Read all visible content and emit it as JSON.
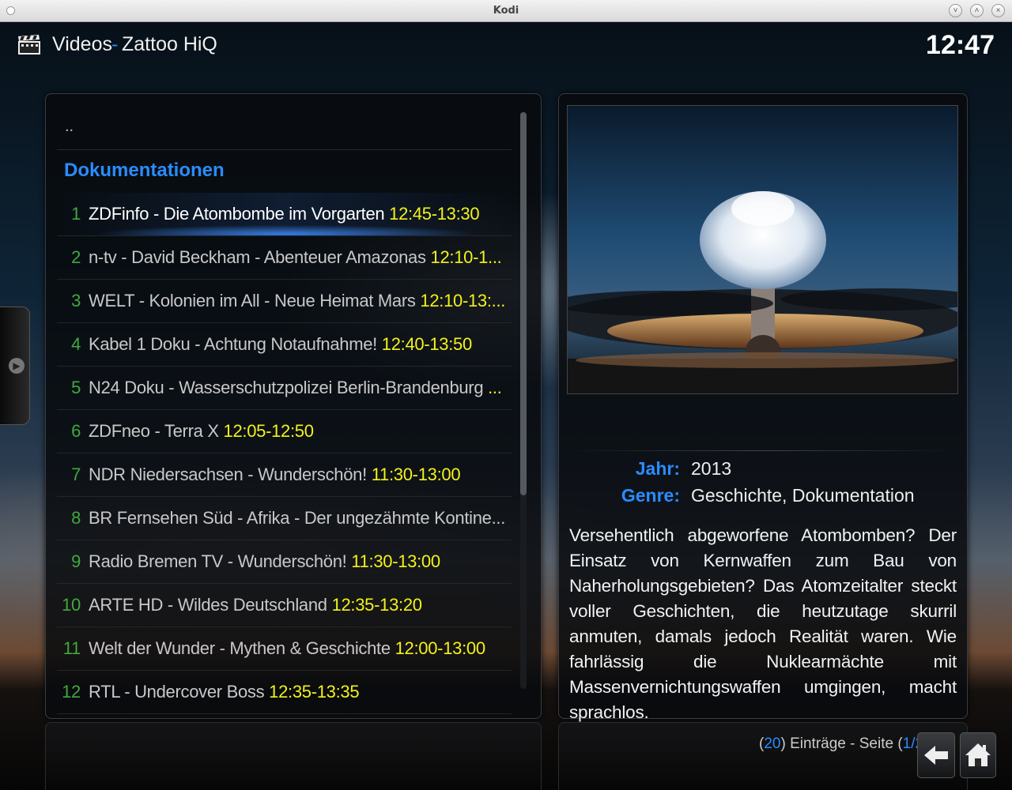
{
  "window": {
    "title": "Kodi"
  },
  "header": {
    "section": "Videos",
    "separator": "-",
    "source": "Zattoo HiQ",
    "clock": "12:47"
  },
  "list": {
    "parent": "..",
    "group": "Dokumentationen",
    "items": [
      {
        "num": "1",
        "name": "ZDFinfo - Die Atombombe im Vorgarten",
        "time": "12:45-13:30"
      },
      {
        "num": "2",
        "name": "n-tv - David Beckham - Abenteuer Amazonas",
        "time": "12:10-1..."
      },
      {
        "num": "3",
        "name": "WELT - Kolonien im All - Neue Heimat Mars",
        "time": "12:10-13:..."
      },
      {
        "num": "4",
        "name": "Kabel 1 Doku - Achtung Notaufnahme!",
        "time": "12:40-13:50"
      },
      {
        "num": "5",
        "name": "N24 Doku - Wasserschutzpolizei Berlin-Brandenburg",
        "time": "..."
      },
      {
        "num": "6",
        "name": "ZDFneo - Terra X",
        "time": "12:05-12:50"
      },
      {
        "num": "7",
        "name": "NDR Niedersachsen - Wunderschön!",
        "time": "11:30-13:00"
      },
      {
        "num": "8",
        "name": "BR Fernsehen Süd - Afrika - Der ungezähmte Kontine...",
        "time": ""
      },
      {
        "num": "9",
        "name": "Radio Bremen TV - Wunderschön!",
        "time": "11:30-13:00"
      },
      {
        "num": "10",
        "name": "ARTE HD - Wildes Deutschland",
        "time": "12:35-13:20"
      },
      {
        "num": "11",
        "name": "Welt der Wunder - Mythen & Geschichte",
        "time": "12:00-13:00"
      },
      {
        "num": "12",
        "name": "RTL - Undercover Boss",
        "time": "12:35-13:35"
      }
    ]
  },
  "info": {
    "year_label": "Jahr:",
    "year": "2013",
    "genre_label": "Genre:",
    "genre": "Geschichte, Dokumentation",
    "plot": "Versehentlich abgeworfene Atombomben? Der Einsatz von Kernwaffen zum Bau von Naherholungsgebieten? Das Atomzeitalter steckt voller Geschichten, die heutzutage skurril anmuten, damals jedoch Realität waren. Wie fahrlässig die Nuklearmächte mit Massenvernichtungswaffen umgingen, macht sprachlos."
  },
  "footer": {
    "open_paren": "(",
    "count": "20",
    "count_text": ") Einträge - Seite (",
    "page": "1/2",
    "close_paren": ")"
  },
  "icons": {
    "header": "clapperboard-icon",
    "back": "back-arrow-icon",
    "home": "home-icon",
    "side": "chevron-right-icon"
  }
}
